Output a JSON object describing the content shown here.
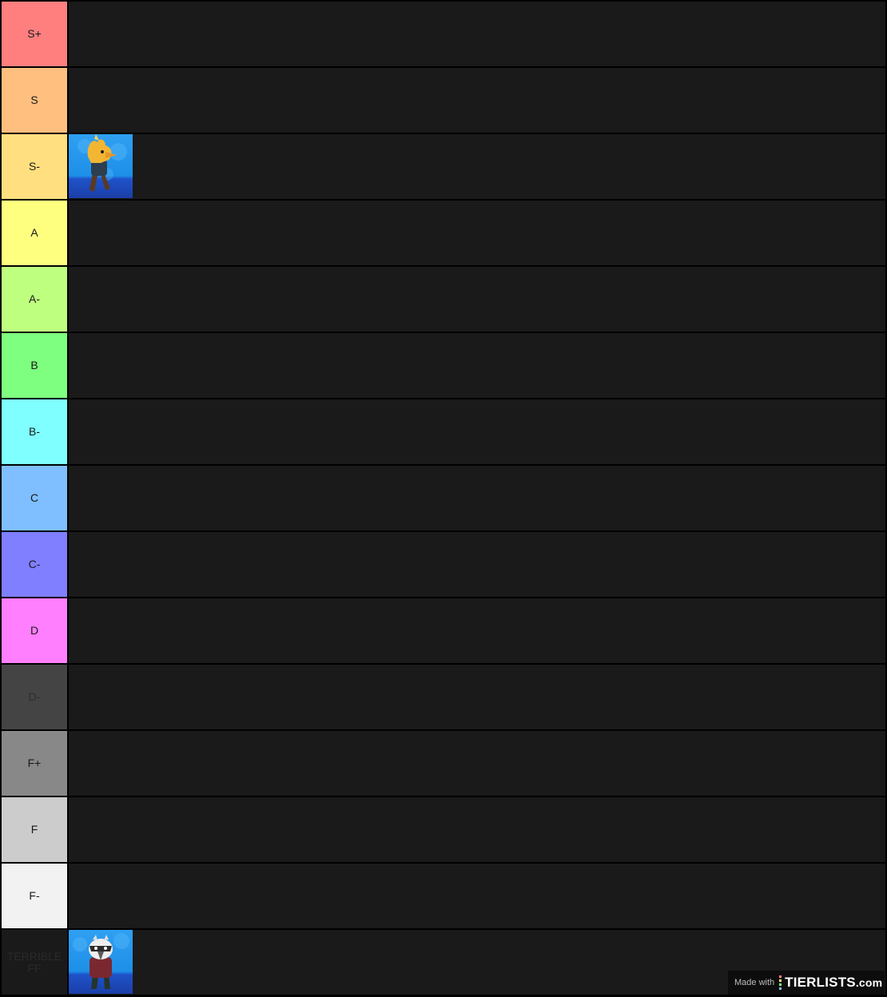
{
  "tiers": [
    {
      "label": "S+",
      "color": "#ff7f7f",
      "text_color": "#1a1a1a"
    },
    {
      "label": "S",
      "color": "#ffbf7f",
      "text_color": "#1a1a1a"
    },
    {
      "label": "S-",
      "color": "#ffdf7f",
      "text_color": "#1a1a1a",
      "items": [
        {
          "name": "Crow (golden skin)",
          "icon": "crow-gold-brawler-icon"
        }
      ]
    },
    {
      "label": "A",
      "color": "#ffff7f",
      "text_color": "#1a1a1a"
    },
    {
      "label": "A-",
      "color": "#bfff7f",
      "text_color": "#1a1a1a"
    },
    {
      "label": "B",
      "color": "#7fff7f",
      "text_color": "#1a1a1a"
    },
    {
      "label": "B-",
      "color": "#7fffff",
      "text_color": "#1a1a1a"
    },
    {
      "label": "C",
      "color": "#7fbfff",
      "text_color": "#1a1a1a"
    },
    {
      "label": "C-",
      "color": "#7f7fff",
      "text_color": "#1a1a1a"
    },
    {
      "label": "D",
      "color": "#ff7fff",
      "text_color": "#1a1a1a"
    },
    {
      "label": "D-",
      "color": "#444444",
      "text_color": "#2e2e2e"
    },
    {
      "label": "F+",
      "color": "#888888",
      "text_color": "#1a1a1a"
    },
    {
      "label": "F",
      "color": "#cccccc",
      "text_color": "#1a1a1a"
    },
    {
      "label": "F-",
      "color": "#f2f2f2",
      "text_color": "#1a1a1a"
    },
    {
      "label": "TERRIBLE FF",
      "color": "#1a1a1a",
      "text_color": "#2a2a2a",
      "items": [
        {
          "name": "Crow (white skin)",
          "icon": "crow-white-brawler-icon"
        }
      ]
    }
  ],
  "watermark": {
    "made_with": "Made with",
    "brand": "TIERLISTS",
    "tld": ".com"
  }
}
